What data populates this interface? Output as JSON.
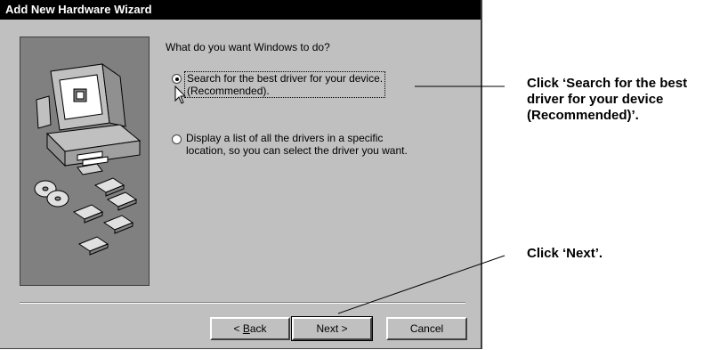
{
  "window": {
    "title": "Add New Hardware Wizard"
  },
  "question": "What do you want Windows to do?",
  "options": [
    {
      "line1": "Search for the best driver for your device.",
      "line2": "(Recommended).",
      "selected": true
    },
    {
      "line1": "Display a list of all the drivers in a specific",
      "line2": "location, so you can select the driver you want.",
      "selected": false
    }
  ],
  "buttons": {
    "back": {
      "prefix": "< ",
      "hotkey": "B",
      "rest": "ack"
    },
    "next": "Next >",
    "cancel": "Cancel"
  },
  "callouts": {
    "search": [
      "Click ‘Search for the best",
      "driver for your device",
      "(Recommended)’."
    ],
    "next": "Click ‘Next’."
  },
  "colors": {
    "dialog_bg": "#c0c0c0",
    "title_bg": "#000000",
    "panel_bg": "#808080"
  }
}
